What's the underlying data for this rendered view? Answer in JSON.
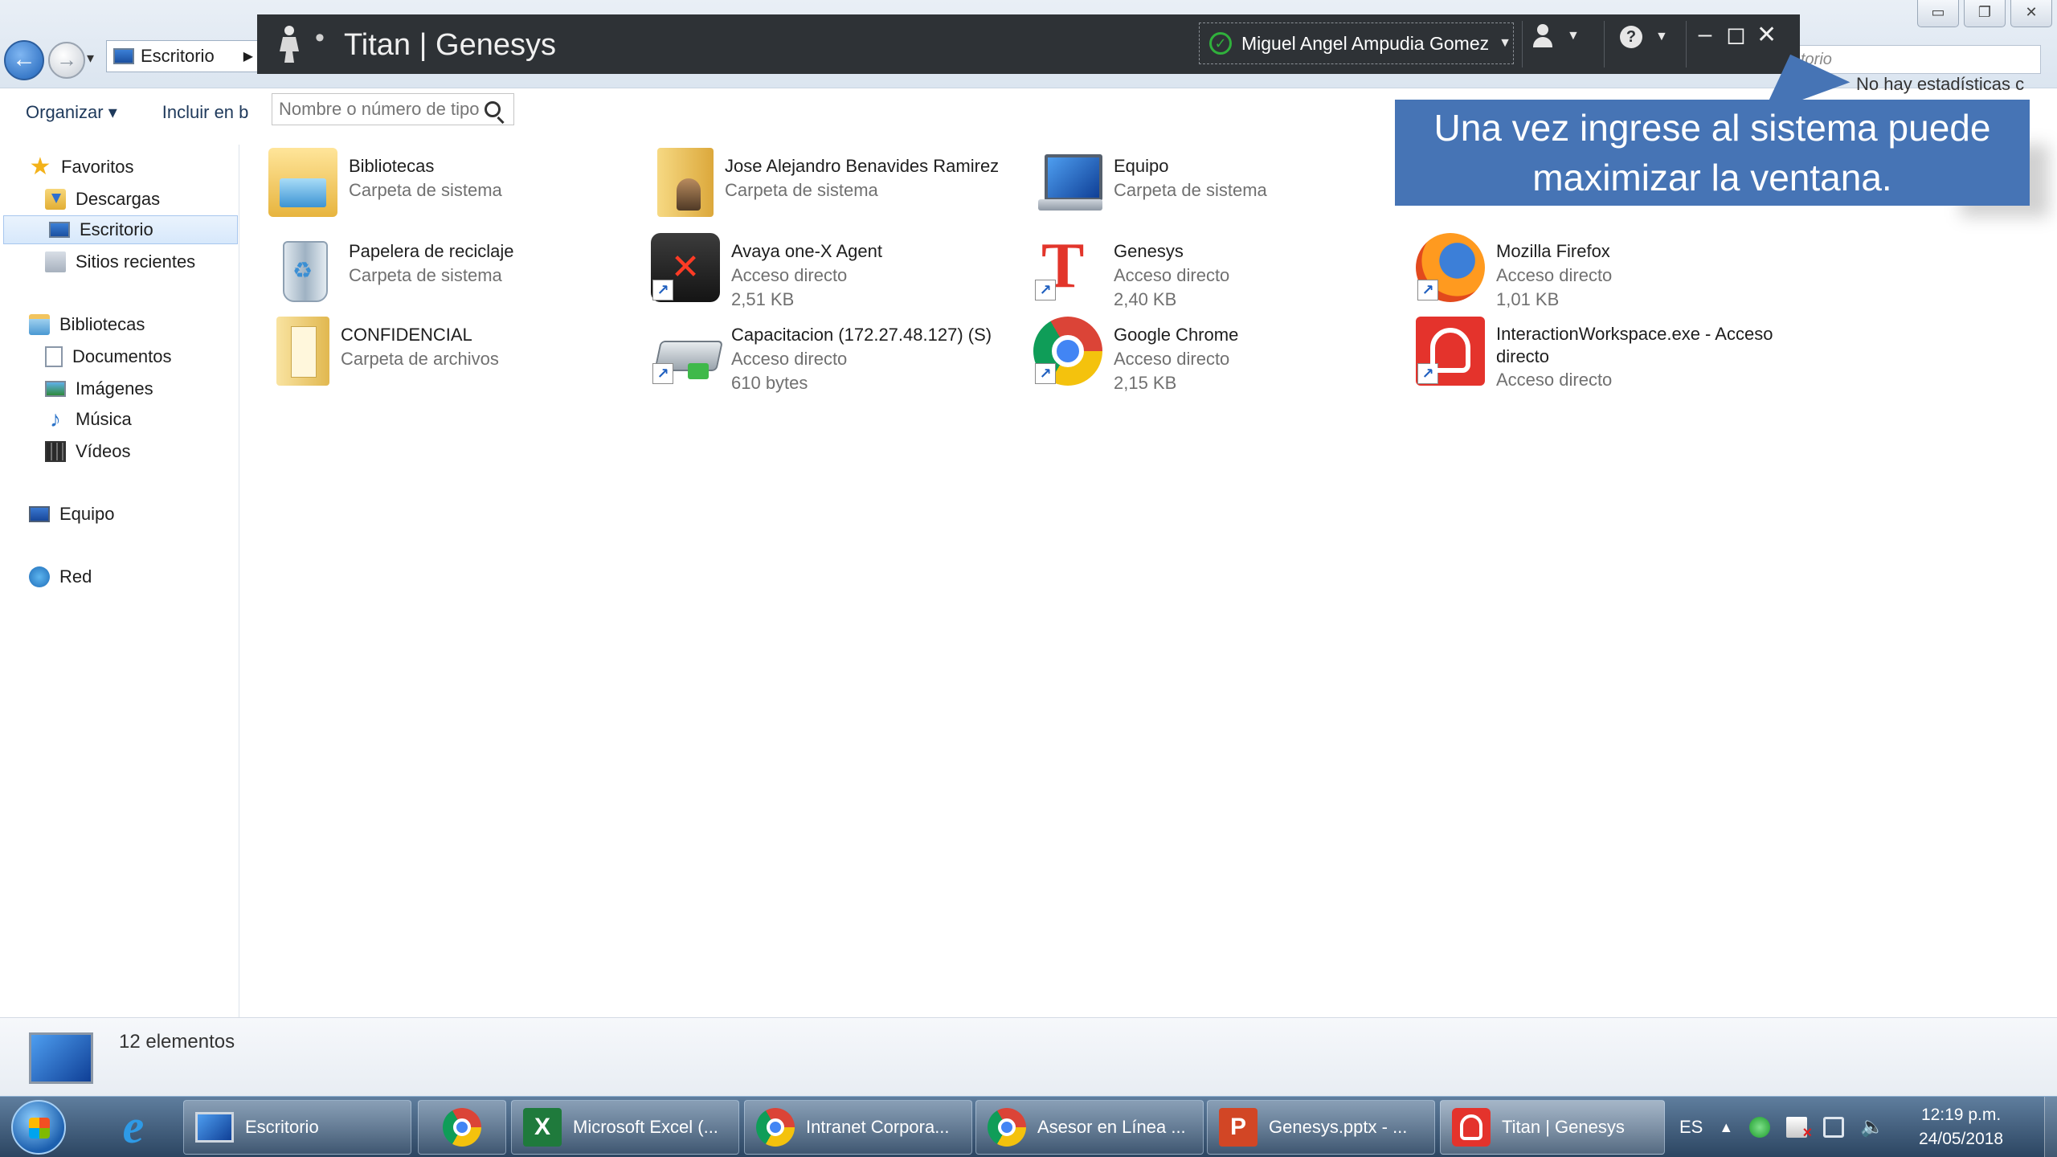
{
  "explorer": {
    "address": "Escritorio",
    "right_search_placeholder": "torio",
    "commands": [
      "Organizar",
      "Incluir en b"
    ],
    "preview_status": "No hay estadísticas c",
    "window_controls": [
      "▭",
      "❐",
      "✕"
    ]
  },
  "sidebar": {
    "favorites": {
      "label": "Favoritos",
      "items": [
        "Descargas",
        "Escritorio",
        "Sitios recientes"
      ]
    },
    "libraries": {
      "label": "Bibliotecas",
      "items": [
        "Documentos",
        "Imágenes",
        "Música",
        "Vídeos"
      ]
    },
    "computer": "Equipo",
    "network": "Red"
  },
  "genesys": {
    "title": "Titan | Genesys",
    "user": "Miguel Angel Ampudia Gomez",
    "search_placeholder": "Nombre o número de tipo",
    "status_color": "#30b13c"
  },
  "files": [
    {
      "name": "Bibliotecas",
      "line1": "Carpeta de sistema",
      "line2": ""
    },
    {
      "name": "Jose Alejandro Benavides Ramirez",
      "line1": "Carpeta de sistema",
      "line2": ""
    },
    {
      "name": "Equipo",
      "line1": "Carpeta de sistema",
      "line2": ""
    },
    {
      "name": "Papelera de reciclaje",
      "line1": "Carpeta de sistema",
      "line2": ""
    },
    {
      "name": "Avaya one-X Agent",
      "line1": "Acceso directo",
      "line2": "2,51 KB"
    },
    {
      "name": "Genesys",
      "line1": "Acceso directo",
      "line2": "2,40 KB"
    },
    {
      "name": "Mozilla Firefox",
      "line1": "Acceso directo",
      "line2": "1,01 KB"
    },
    {
      "name": "CONFIDENCIAL",
      "line1": "Carpeta de archivos",
      "line2": ""
    },
    {
      "name": "Capacitacion (172.27.48.127) (S)",
      "line1": "Acceso directo",
      "line2": "610 bytes"
    },
    {
      "name": "Google Chrome",
      "line1": "Acceso directo",
      "line2": "2,15 KB"
    },
    {
      "name": "InteractionWorkspace.exe - Acceso directo",
      "line1": "Acceso directo",
      "line2": ""
    }
  ],
  "callout": {
    "text": "Una vez ingrese al sistema  puede maximizar la ventana.",
    "color": "#4674b5"
  },
  "details": {
    "count": "12 elementos"
  },
  "taskbar": {
    "buttons": [
      "Escritorio",
      "",
      "Microsoft Excel (...",
      "Intranet Corpora...",
      "Asesor en Línea ...",
      "Genesys.pptx - ...",
      "Titan | Genesys"
    ],
    "language": "ES",
    "time": "12:19 p.m.",
    "date": "24/05/2018"
  }
}
